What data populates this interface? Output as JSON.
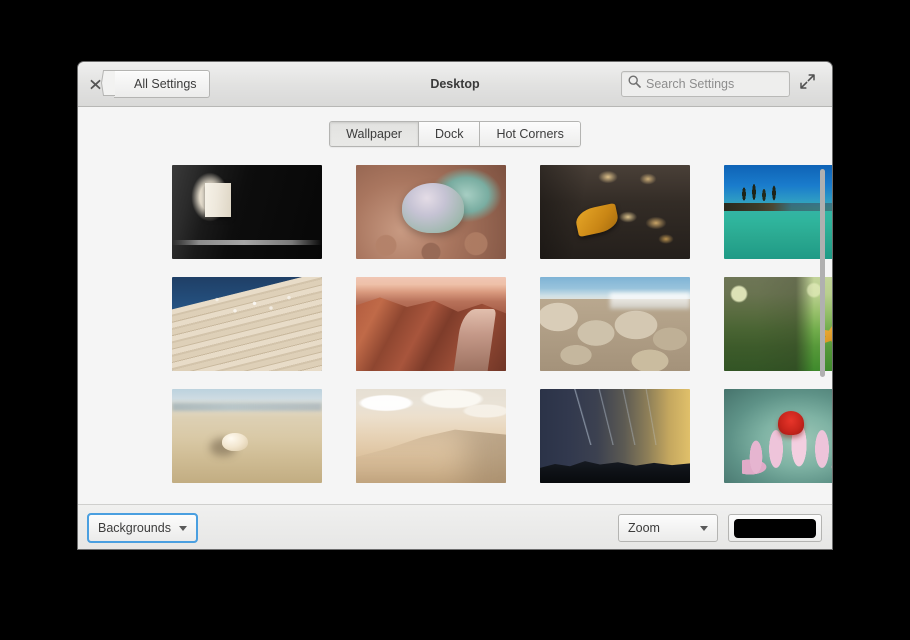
{
  "window": {
    "title": "Desktop",
    "close_icon": "close-x-icon",
    "maximize_icon": "maximize-diagonal-arrows-icon",
    "back_button": {
      "label": "All Settings",
      "icon": "chevron-left-icon"
    },
    "search": {
      "placeholder": "Search Settings",
      "icon": "search-magnifier-icon",
      "value": ""
    }
  },
  "tabs": [
    {
      "label": "Wallpaper",
      "active": true
    },
    {
      "label": "Dock",
      "active": false
    },
    {
      "label": "Hot Corners",
      "active": false
    }
  ],
  "wallpapers": [
    {
      "name": "japanese-lantern",
      "alt": "Paper lantern with calligraphy on dark wooden building",
      "art": "t-lantern"
    },
    {
      "name": "succulent-pebbles",
      "alt": "Pale green succulent plant among pink pebbles",
      "art": "t-succulent"
    },
    {
      "name": "autumn-leaves-deck",
      "alt": "Golden autumn leaves on weathered dark wood planks",
      "art": "t-leaves"
    },
    {
      "name": "turquoise-lake",
      "alt": "Turquoise lake with pine trees on rocky island and blue sky",
      "art": "t-lake"
    },
    {
      "name": "wooden-dock-water",
      "alt": "Wooden dock edge meeting dark rippling blue water",
      "art": "t-dock"
    },
    {
      "name": "red-canyon-river",
      "alt": "Red sandstone canyon with winding river at sunset",
      "art": "t-canyon"
    },
    {
      "name": "coastal-boulders",
      "alt": "Pale boulders along a shoreline with breaking surf",
      "art": "t-rocks"
    },
    {
      "name": "maple-leaf-grass",
      "alt": "Single orange maple leaf resting on green grass",
      "art": "t-grass"
    },
    {
      "name": "seashell-beach",
      "alt": "White seashell on golden sand beach near the sea",
      "art": "t-shell"
    },
    {
      "name": "sand-dunes",
      "alt": "Rolling sand dunes under soft cloudy sky",
      "art": "t-dunes"
    },
    {
      "name": "twilight-mountains",
      "alt": "Twilight sky with star trails over dark mountain ridge",
      "art": "t-night"
    },
    {
      "name": "pink-water-lily",
      "alt": "Pink water lily with red stamens on teal background",
      "art": "t-lotus"
    }
  ],
  "footer": {
    "source_dropdown": {
      "label": "Backgrounds",
      "icon": "caret-down-icon",
      "focused": true
    },
    "fit_dropdown": {
      "label": "Zoom",
      "icon": "caret-down-icon"
    },
    "color_swatch": {
      "name": "background-color-swatch",
      "color": "#000000"
    }
  },
  "scrollbar": {
    "name": "wallpaper-grid-scrollbar",
    "color": "#b0b0b0"
  },
  "theme": {
    "desktop_background": "#000000",
    "window_background": "#f5f5f5",
    "titlebar_gradient_top": "#f0f0ef",
    "titlebar_gradient_bottom": "#d9d9d8",
    "focus_ring": "#4a9fe0",
    "text": "#3c3c3c",
    "placeholder_text": "#8d8d8d"
  }
}
